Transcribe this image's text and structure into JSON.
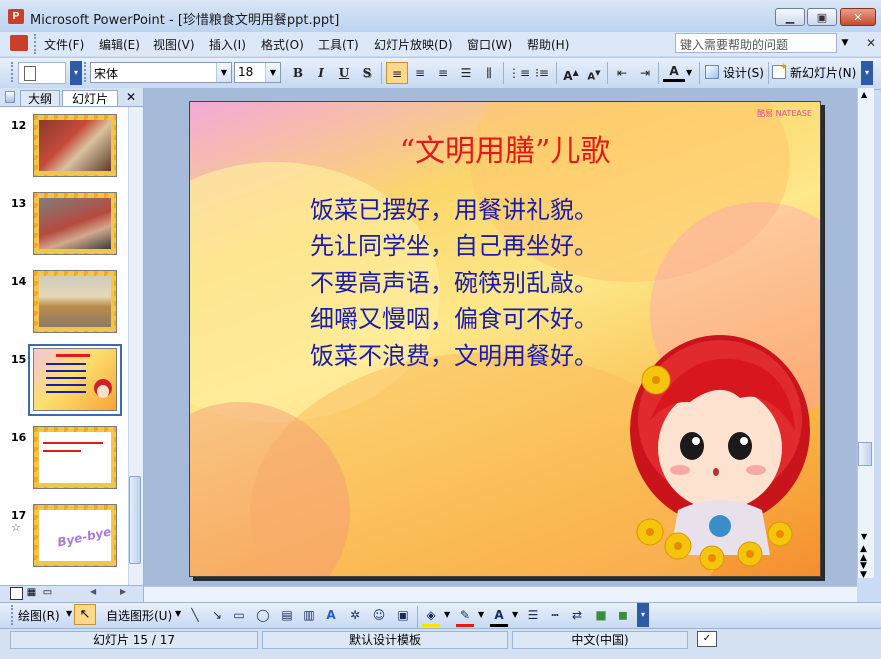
{
  "window": {
    "title": "Microsoft PowerPoint - [珍惜粮食文明用餐ppt.ppt]",
    "minimize": "▁",
    "restore": "▣",
    "close": "✕"
  },
  "menubar": {
    "items": [
      "文件(F)",
      "编辑(E)",
      "视图(V)",
      "插入(I)",
      "格式(O)",
      "工具(T)",
      "幻灯片放映(D)",
      "窗口(W)",
      "帮助(H)"
    ],
    "help_placeholder": "键入需要帮助的问题",
    "help_dropdown": "▼",
    "close": "✕"
  },
  "toolbar": {
    "font_name": "宋体",
    "font_size": "18",
    "bold": "B",
    "italic": "I",
    "underline": "U",
    "shadow": "S",
    "font_color": "A",
    "design_label": "设计(S)",
    "new_slide_label": "新幻灯片(N)"
  },
  "left_panel": {
    "tab_outline": "大纲",
    "tab_slides": "幻灯片",
    "close": "✕",
    "slides": [
      {
        "number": "12"
      },
      {
        "number": "13"
      },
      {
        "number": "14"
      },
      {
        "number": "15"
      },
      {
        "number": "16"
      },
      {
        "number": "17"
      }
    ],
    "bye_text": "Bye-bye",
    "star": "☆"
  },
  "slide": {
    "logo": "酷易 NATEASE",
    "title": "“文明用膳”儿歌",
    "lines": [
      "饭菜已摆好，用餐讲礼貌。",
      "先让同学坐，自己再坐好。",
      "不要高声语，碗筷别乱敲。",
      "细嚼又慢咽，偏食可不好。",
      "饭菜不浪费，文明用餐好。"
    ],
    "title_color": "#e21a1a",
    "text_color": "#1a1cae"
  },
  "drawbar": {
    "draw_label": "绘图(R)",
    "autoshapes_label": "自选图形(U)"
  },
  "statusbar": {
    "slide_position": "幻灯片 15 / 17",
    "template": "默认设计模板",
    "language": "中文(中国)"
  }
}
